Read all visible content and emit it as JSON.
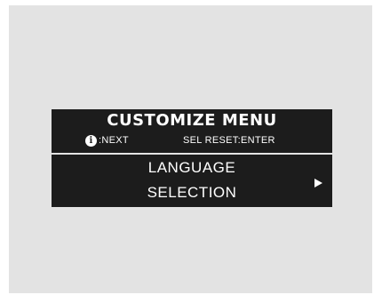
{
  "menu": {
    "title": "CUSTOMIZE MENU",
    "hint_left": {
      "icon": "info-icon",
      "icon_glyph": "i",
      "label": ":NEXT"
    },
    "hint_right": "SEL RESET:ENTER",
    "item": {
      "line1": "LANGUAGE",
      "line2": "SELECTION",
      "arrow_icon": "right-arrow-icon"
    }
  },
  "colors": {
    "background": "#e3e3e3",
    "panel": "#1c1c1c",
    "text": "#ffffff"
  }
}
